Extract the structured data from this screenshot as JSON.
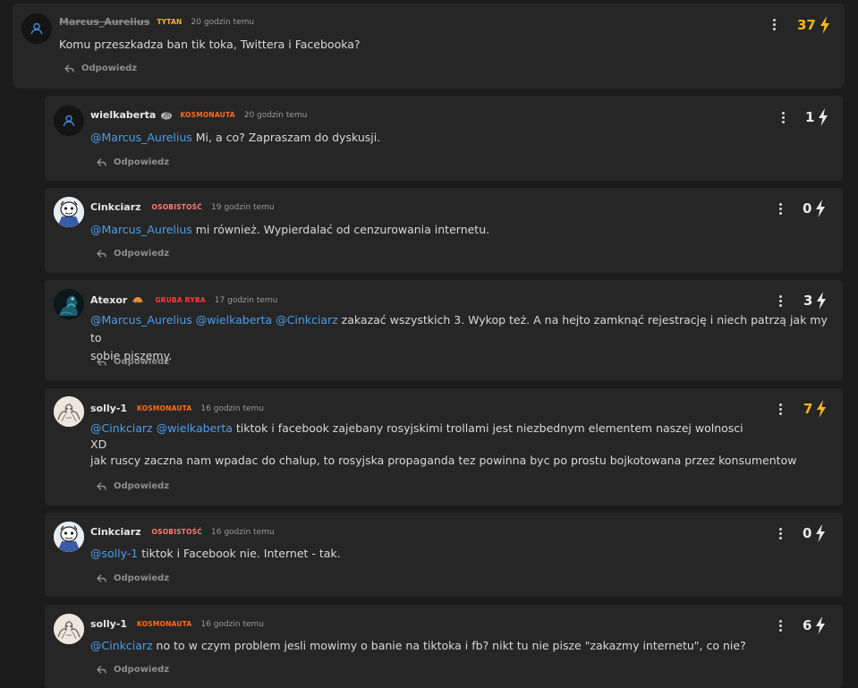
{
  "colors": {
    "mention": "#4a9eed",
    "highlight_score": "#f5b816",
    "rank_tytan": "#f5b816",
    "rank_kosmonauta": "#ff6b1a",
    "rank_osobistosc": "#ff7a6e",
    "rank_gruba_ryba": "#ff3b3b"
  },
  "reply_label": "Odpowiedz",
  "root": {
    "user": "Marcus_Aurelius",
    "rank": "TYTAN",
    "time": "20 godzin temu",
    "score": "37",
    "text": "Komu przeszkadza ban tik toka, Twittera i Facebooka?",
    "avatar": "default-user-icon"
  },
  "replies": [
    {
      "user": "wielkaberta",
      "rank": "KOSMONAUTA",
      "time": "20 godzin temu",
      "score": "1",
      "avatar": "default-user-icon",
      "mentions": [
        "@Marcus_Aurelius"
      ],
      "text": " Mi, a co? Zapraszam do dyskusji."
    },
    {
      "user": "Cinkciarz",
      "rank": "OSOBISTOŚĆ",
      "time": "19 godzin temu",
      "score": "0",
      "avatar": "cartoon-avatar",
      "mentions": [
        "@Marcus_Aurelius"
      ],
      "text": " mi również. Wypierdalać od cenzurowania internetu."
    },
    {
      "user": "Atexor",
      "rank": "GRUBA RYBA",
      "time": "17 godzin temu",
      "score": "3",
      "avatar": "dark-creature-avatar",
      "mentions": [
        "@Marcus_Aurelius",
        "@wielkaberta",
        "@Cinkciarz"
      ],
      "text_line1": " zakazać wszystkich 3. Wykop też. A na hejto zamknąć rejestrację i niech patrzą jak my to",
      "text_line2": "sobie piszemy."
    },
    {
      "user": "solly-1",
      "rank": "KOSMONAUTA",
      "time": "16 godzin temu",
      "score": "7",
      "avatar": "sketch-avatar",
      "mentions": [
        "@Cinkciarz",
        "@wielkaberta"
      ],
      "text_line1": " tiktok i facebook zajebany rosyjskimi trollami jest niezbednym elementem naszej wolnosci",
      "text_line2": "XD",
      "text_line3": "jak ruscy zaczna nam wpadac do chalup, to rosyjska propaganda tez powinna byc po prostu bojkotowana przez konsumentow"
    },
    {
      "user": "Cinkciarz",
      "rank": "OSOBISTOŚĆ",
      "time": "16 godzin temu",
      "score": "0",
      "avatar": "cartoon-avatar",
      "mentions": [
        "@solly-1"
      ],
      "text": " tiktok i Facebook nie. Internet - tak."
    },
    {
      "user": "solly-1",
      "rank": "KOSMONAUTA",
      "time": "16 godzin temu",
      "score": "6",
      "avatar": "sketch-avatar",
      "mentions": [
        "@Cinkciarz"
      ],
      "text": " no to w czym problem jesli mowimy o banie na tiktoka i fb? nikt tu nie pisze \"zakazmy internetu\", co nie?"
    }
  ]
}
